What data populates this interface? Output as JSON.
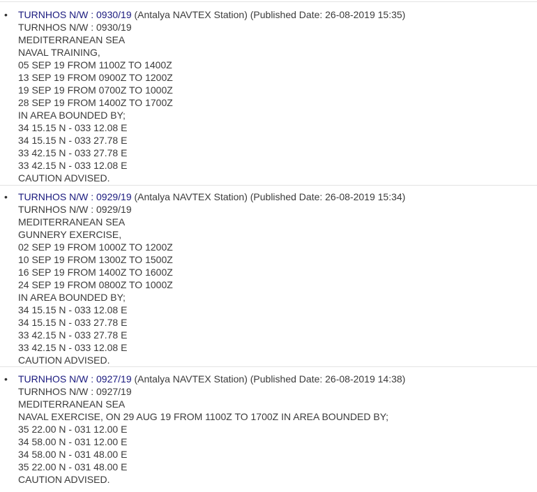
{
  "notices": [
    {
      "link_text": "TURNHOS N/W : 0930/19",
      "meta": "(Antalya NAVTEX Station) (Published Date: 26-08-2019 15:35)",
      "lines": [
        "TURNHOS N/W : 0930/19",
        "MEDITERRANEAN SEA",
        "NAVAL TRAINING,",
        "05 SEP 19 FROM 1100Z TO 1400Z",
        "13 SEP 19 FROM 0900Z TO 1200Z",
        "19 SEP 19 FROM 0700Z TO 1000Z",
        "28 SEP 19 FROM 1400Z TO 1700Z",
        "IN AREA BOUNDED BY;",
        "34 15.15 N - 033 12.08 E",
        "34 15.15 N - 033 27.78 E",
        "33 42.15 N - 033 27.78 E",
        "33 42.15 N - 033 12.08 E",
        "CAUTION ADVISED."
      ]
    },
    {
      "link_text": "TURNHOS N/W : 0929/19",
      "meta": "(Antalya NAVTEX Station) (Published Date: 26-08-2019 15:34)",
      "lines": [
        "TURNHOS N/W : 0929/19",
        "MEDITERRANEAN SEA",
        "GUNNERY EXERCISE,",
        "02 SEP 19 FROM 1000Z TO 1200Z",
        "10 SEP 19 FROM 1300Z TO 1500Z",
        "16 SEP 19 FROM 1400Z TO 1600Z",
        "24 SEP 19 FROM 0800Z TO 1000Z",
        "IN AREA BOUNDED BY;",
        "34 15.15 N - 033 12.08 E",
        "34 15.15 N - 033 27.78 E",
        "33 42.15 N - 033 27.78 E",
        "33 42.15 N - 033 12.08 E",
        "CAUTION ADVISED."
      ]
    },
    {
      "link_text": "TURNHOS N/W : 0927/19",
      "meta": "(Antalya NAVTEX Station) (Published Date: 26-08-2019 14:38)",
      "lines": [
        "TURNHOS N/W : 0927/19",
        "MEDITERRANEAN SEA",
        "NAVAL EXERCISE, ON 29 AUG 19 FROM 1100Z TO 1700Z IN AREA BOUNDED BY;",
        "35 22.00 N - 031 12.00 E",
        "34 58.00 N - 031 12.00 E",
        "34 58.00 N - 031 48.00 E",
        "35 22.00 N - 031 48.00 E",
        "CAUTION ADVISED."
      ]
    }
  ],
  "bullet_glyph": "•"
}
